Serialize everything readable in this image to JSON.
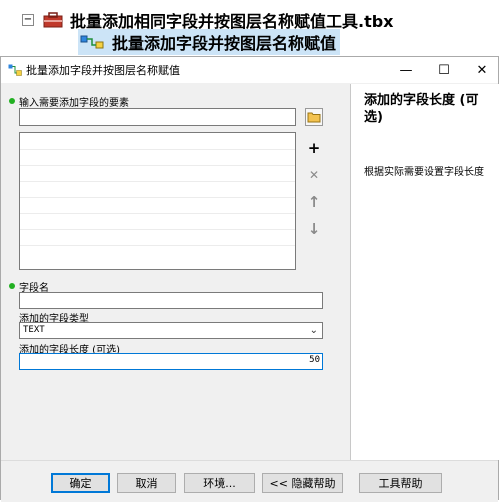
{
  "tree": {
    "parent_label": "批量添加相同字段并按图层名称赋值工具.tbx",
    "tool_label": "批量添加字段并按图层名称赋值",
    "expander_symbol": "−"
  },
  "dialog": {
    "title": "批量添加字段并按图层名称赋值",
    "window_buttons": {
      "minimize": "—",
      "maximize": "☐",
      "close": "✕"
    },
    "fields": {
      "input_features_label": "输入需要添加字段的要素",
      "field_name_label": "字段名",
      "field_type_label": "添加的字段类型",
      "field_type_value": "TEXT",
      "field_length_label": "添加的字段长度 (可选)",
      "field_length_value": "50"
    },
    "side_buttons": {
      "add": "+",
      "remove": "✕",
      "up": "↑",
      "down": "↓"
    },
    "help": {
      "title": "添加的字段长度 (可选)",
      "description": "根据实际需要设置字段长度"
    },
    "footer": {
      "ok": "确定",
      "cancel": "取消",
      "environments": "环境...",
      "hide_help": "<< 隐藏帮助",
      "tool_help": "工具帮助"
    },
    "colors": {
      "required_dot": "#22b022",
      "focus": "#0078d7",
      "help_bg": "#ffffff"
    }
  }
}
